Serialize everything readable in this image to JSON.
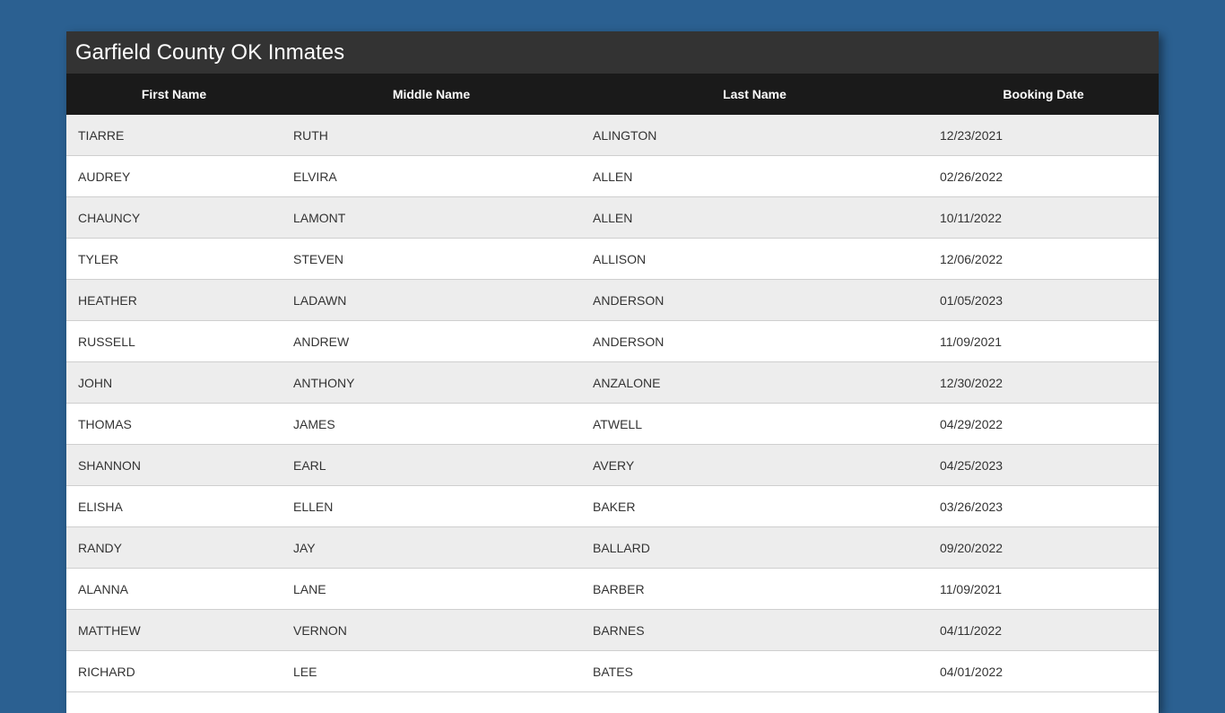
{
  "page": {
    "title": "Garfield County OK Inmates"
  },
  "table": {
    "headers": [
      "First Name",
      "Middle Name",
      "Last Name",
      "Booking Date"
    ],
    "rows": [
      [
        "TIARRE",
        "RUTH",
        "ALINGTON",
        "12/23/2021"
      ],
      [
        "AUDREY",
        "ELVIRA",
        "ALLEN",
        "02/26/2022"
      ],
      [
        "CHAUNCY",
        "LAMONT",
        "ALLEN",
        "10/11/2022"
      ],
      [
        "TYLER",
        "STEVEN",
        "ALLISON",
        "12/06/2022"
      ],
      [
        "HEATHER",
        "LADAWN",
        "ANDERSON",
        "01/05/2023"
      ],
      [
        "RUSSELL",
        "ANDREW",
        "ANDERSON",
        "11/09/2021"
      ],
      [
        "JOHN",
        "ANTHONY",
        "ANZALONE",
        "12/30/2022"
      ],
      [
        "THOMAS",
        "JAMES",
        "ATWELL",
        "04/29/2022"
      ],
      [
        "SHANNON",
        "EARL",
        "AVERY",
        "04/25/2023"
      ],
      [
        "ELISHA",
        "ELLEN",
        "BAKER",
        "03/26/2023"
      ],
      [
        "RANDY",
        "JAY",
        "BALLARD",
        "09/20/2022"
      ],
      [
        "ALANNA",
        "LANE",
        "BARBER",
        "11/09/2021"
      ],
      [
        "MATTHEW",
        "VERNON",
        "BARNES",
        "04/11/2022"
      ],
      [
        "RICHARD",
        "LEE",
        "BATES",
        "04/01/2022"
      ]
    ]
  },
  "colors": {
    "background": "#2b6091",
    "title_bar": "#333333",
    "header_row": "#1a1a1a",
    "row_odd": "#ededed",
    "row_even": "#ffffff"
  }
}
